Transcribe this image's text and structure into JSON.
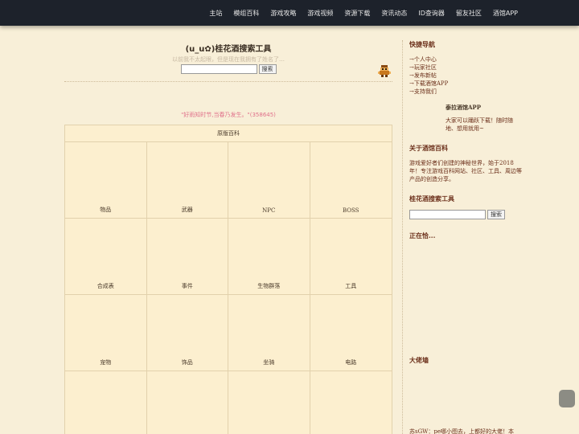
{
  "nav": {
    "items": [
      "主站",
      "模组百科",
      "游戏攻略",
      "游戏视频",
      "资源下载",
      "资讯动态",
      "ID查询器",
      "留友社区",
      "酒馆APP"
    ]
  },
  "search": {
    "title": "(u_u✿)桂花酒搜索工具",
    "subtitle": "以前我不太起眼，但是现在我拥有了姓名了…",
    "input_value": "",
    "button_label": "搜索"
  },
  "quote": "\"好雨知时节,当春乃发生。\"(358645)",
  "wiki": {
    "header": "原版百科",
    "cells": [
      "物品",
      "武器",
      "NPC",
      "BOSS",
      "合成表",
      "事件",
      "生物群落",
      "工具",
      "宠物",
      "饰品",
      "坐骑",
      "电路",
      "",
      "",
      "",
      ""
    ]
  },
  "sidebar": {
    "quick_title": "快捷导航",
    "quick_links": [
      "→个人中心",
      "→玩家社区",
      "→发布新帖",
      "→下载酒馆APP",
      "→支持我们"
    ],
    "app_title": "泰拉酒馆APP",
    "app_text": "大家可以踊跃下载！随时随地、想用就用~",
    "about_title": "关于酒馆百科",
    "about_text": "游戏爱好者们创建的神秘世界，始于2018年！专注游戏百科网站、社区、工具、周边等产品的创造分享。",
    "search_title": "桂花酒搜索工具",
    "search_button": "搜索",
    "now_title": "正在恰...",
    "wall_title": "大佬墙",
    "bottom_text": "苏sGW：pe哪小图去，上都好的大佬！本"
  },
  "colors": {
    "topbar": "#1d222b",
    "background": "#f8efd8",
    "link": "#6b2f1a",
    "quote": "#e0708a"
  }
}
